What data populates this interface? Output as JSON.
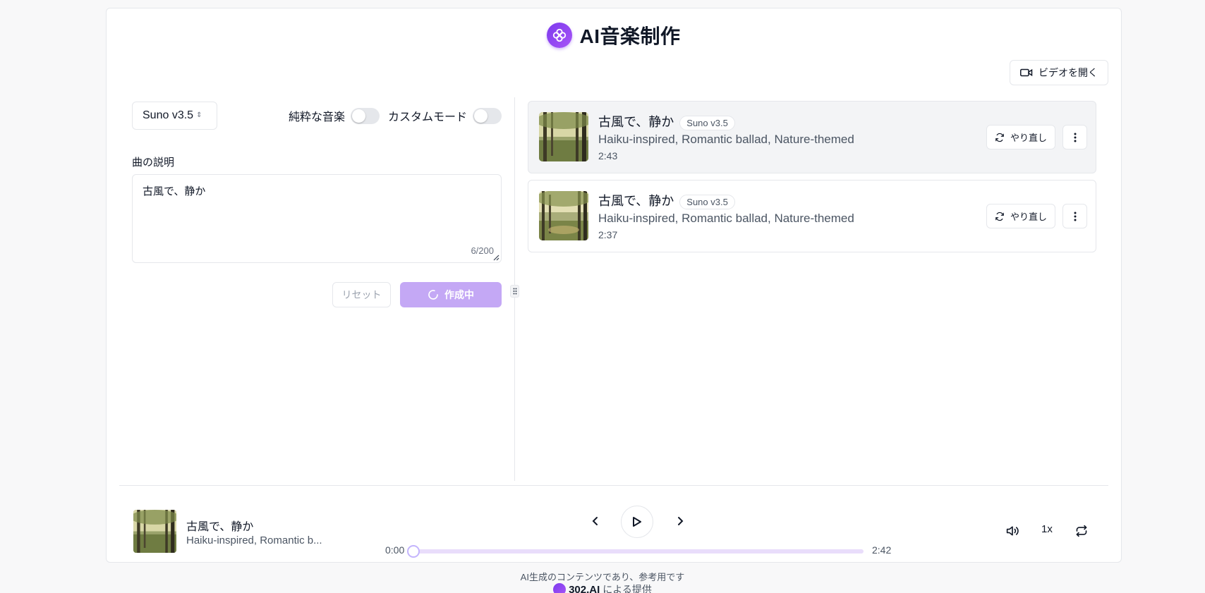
{
  "app": {
    "title": "AI音楽制作"
  },
  "toolbar": {
    "video_label": "ビデオを開く"
  },
  "form": {
    "model": "Suno v3.5",
    "instrumental_label": "純粋な音楽",
    "instrumental_on": false,
    "custom_mode_label": "カスタムモード",
    "custom_mode_on": false,
    "description_label": "曲の説明",
    "description_value": "古風で、静か",
    "char_count": "6/200",
    "reset_label": "リセット",
    "create_label": "作成中"
  },
  "songs": [
    {
      "title": "古風で、静か",
      "badge": "Suno v3.5",
      "tags": "Haiku-inspired, Romantic ballad, Nature-themed",
      "duration": "2:43",
      "retry_label": "やり直し",
      "active": true
    },
    {
      "title": "古風で、静か",
      "badge": "Suno v3.5",
      "tags": "Haiku-inspired, Romantic ballad, Nature-themed",
      "duration": "2:37",
      "retry_label": "やり直し",
      "active": false
    }
  ],
  "player": {
    "title": "古風で、静か",
    "tags": "Haiku-inspired, Romantic b...",
    "current_time": "0:00",
    "total_time": "2:42",
    "progress": 0,
    "speed": "1x"
  },
  "footer": {
    "note": "AI生成のコンテンツであり、参考用です",
    "brand": "302.AI",
    "brand_suffix": "による提供"
  },
  "colors": {
    "accent": "#7c3aed",
    "button_loading": "#c4a8f5",
    "progress_track": "#e9ddfb"
  }
}
